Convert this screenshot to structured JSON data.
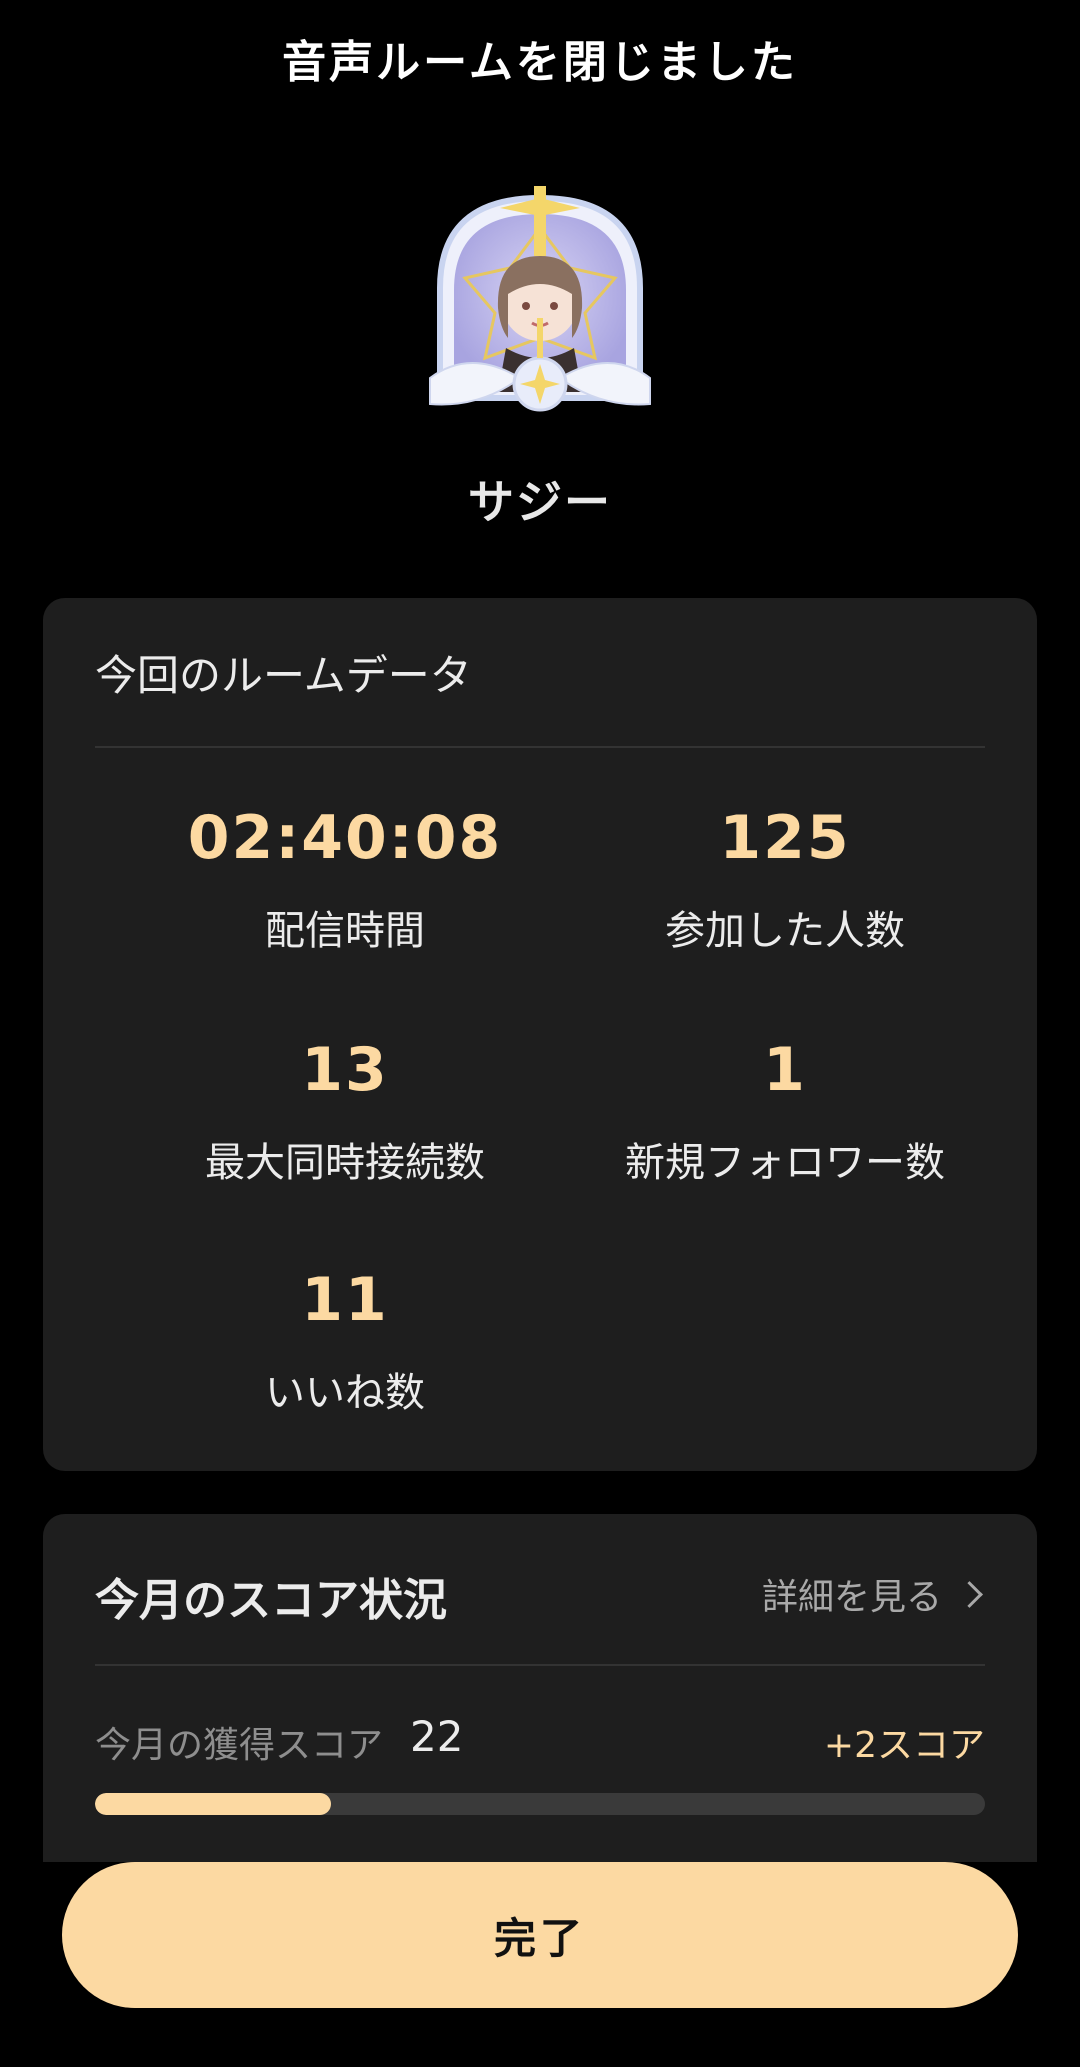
{
  "header": {
    "title": "音声ルームを閉じました"
  },
  "host": {
    "name": "サジー"
  },
  "room_data": {
    "title": "今回のルームデータ",
    "stats": [
      {
        "value": "02:40:08",
        "label": "配信時間"
      },
      {
        "value": "125",
        "label": "参加した人数"
      },
      {
        "value": "13",
        "label": "最大同時接続数"
      },
      {
        "value": "1",
        "label": "新規フォロワー数"
      },
      {
        "value": "11",
        "label": "いいね数"
      }
    ]
  },
  "score": {
    "title": "今月のスコア状況",
    "detail_link": "詳細を見る",
    "earned_label": "今月の獲得スコア",
    "earned_value": "22",
    "delta": "+2スコア",
    "progress_fraction": 0.265
  },
  "footer": {
    "done_label": "完了"
  },
  "colors": {
    "background": "#000000",
    "card": "#1e1e1e",
    "accent": "#fcd9a2",
    "text": "#ececec",
    "muted": "#8e8e8e"
  },
  "icons": {
    "detail": "chevron-right-icon"
  }
}
